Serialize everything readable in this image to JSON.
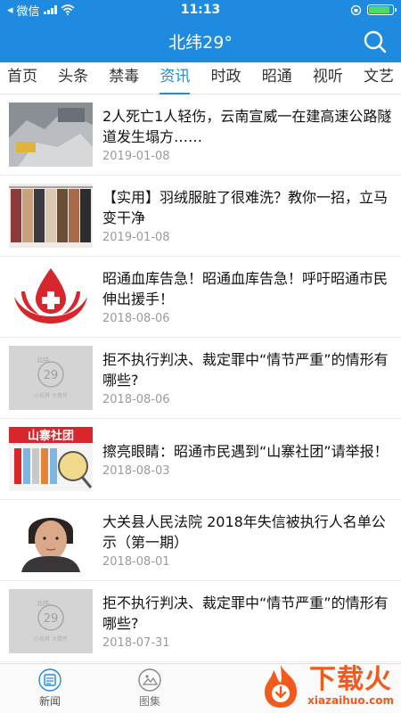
{
  "status_bar": {
    "carrier": "微信",
    "time": "11:13",
    "battery_level": 0.9
  },
  "header": {
    "title": "北纬29°"
  },
  "tabs": [
    {
      "label": "首页"
    },
    {
      "label": "头条"
    },
    {
      "label": "禁毒"
    },
    {
      "label": "资讯",
      "active": true
    },
    {
      "label": "时政"
    },
    {
      "label": "昭通"
    },
    {
      "label": "视听"
    },
    {
      "label": "文艺"
    }
  ],
  "news": [
    {
      "title": "2人死亡1人轻伤，云南宣威一在建高速公路隧道发生塌方……",
      "date": "2019-01-08"
    },
    {
      "title": "【实用】羽绒服脏了很难洗？教你一招，立马变干净",
      "date": "2019-01-08"
    },
    {
      "title": "昭通血库告急！昭通血库告急！呼吁昭通市民伸出援手！",
      "date": "2018-08-06"
    },
    {
      "title": "拒不执行判决、裁定罪中“情节严重”的情形有哪些?",
      "date": "2018-08-06"
    },
    {
      "title": "擦亮眼睛：昭通市民遇到“山寨社团”请举报！",
      "date": "2018-08-03"
    },
    {
      "title": "大关县人民法院 2018年失信被执行人名单公示（第一期）",
      "date": "2018-08-01"
    },
    {
      "title": "拒不执行判决、裁定罪中“情节严重”的情形有哪些?",
      "date": "2018-07-31"
    }
  ],
  "thumbs": {
    "placeholder_logo_text": "29",
    "placeholder_brand": "北纬",
    "placeholder_slogan": "小视界 大情怀",
    "banner_text": "山寨社团"
  },
  "bottom_nav": {
    "news_label": "新闻",
    "gallery_label": "图集"
  },
  "watermark": {
    "text": "下载火",
    "url": "xiazaihuo.com"
  },
  "colors": {
    "primary": "#1e8be1",
    "watermark": "#f25a1c"
  }
}
